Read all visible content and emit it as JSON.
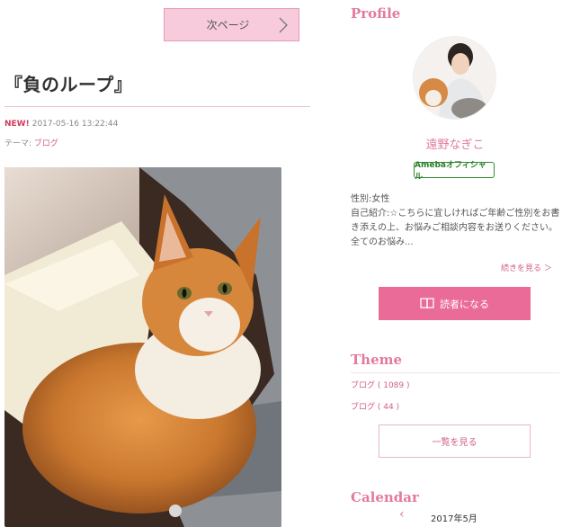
{
  "article": {
    "next_page_label": "次ページ",
    "title": "『負のループ』",
    "new_badge": "NEW!",
    "date": "2017-05-16 13:22:44",
    "theme_prefix": "テーマ:",
    "theme_link": "ブログ"
  },
  "profile": {
    "heading": "Profile",
    "name": "遠野なぎこ",
    "official_badge": "Amebaオフィシャル",
    "gender_line": "性別:女性",
    "intro": "自己紹介:☆こちらに宜しければご年齢ご性別をお書き添えの上、お悩みご相談内容をお送りください。全てのお悩み...",
    "more_link": "続きを見る ＞",
    "reader_button": "読者になる"
  },
  "theme": {
    "heading": "Theme",
    "items": [
      {
        "label": "ブログ ( 1089 )"
      },
      {
        "label": "ブログ ( 44 )"
      }
    ],
    "view_all": "一覧を見る"
  },
  "calendar": {
    "heading": "Calendar",
    "prev_glyph": "‹",
    "month": "2017年5月"
  },
  "colors": {
    "accent_pink": "#e27aa0",
    "button_pink": "#ea6a98",
    "next_bg": "#f7cbdc"
  }
}
